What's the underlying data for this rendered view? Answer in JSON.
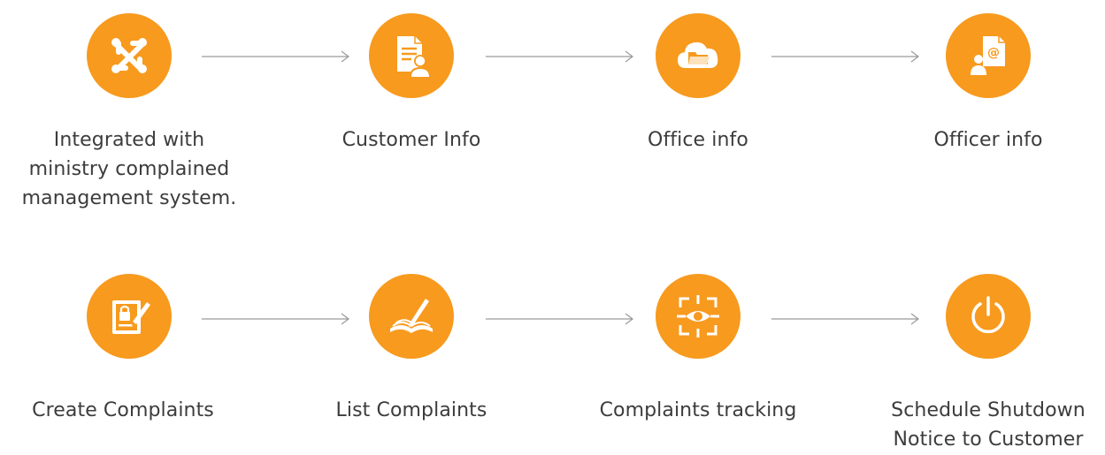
{
  "accent_color": "#f79a1e",
  "line_color": "#9a9a9a",
  "text_color": "#3c3c3c",
  "rows": [
    {
      "steps": [
        {
          "label": "Integrated with\nministry complained\nmanagement system.",
          "icon": "joomla-icon"
        },
        {
          "label": "Customer Info",
          "icon": "customer-document-icon"
        },
        {
          "label": "Office info",
          "icon": "cloud-folder-icon"
        },
        {
          "label": "Officer info",
          "icon": "contact-email-icon"
        }
      ]
    },
    {
      "steps": [
        {
          "label": "Create Complaints",
          "icon": "secure-form-edit-icon"
        },
        {
          "label": "List Complaints",
          "icon": "open-book-pen-icon"
        },
        {
          "label": "Complaints tracking",
          "icon": "eye-target-icon"
        },
        {
          "label": "Schedule Shutdown\nNotice to Customer",
          "icon": "power-icon"
        }
      ]
    }
  ]
}
